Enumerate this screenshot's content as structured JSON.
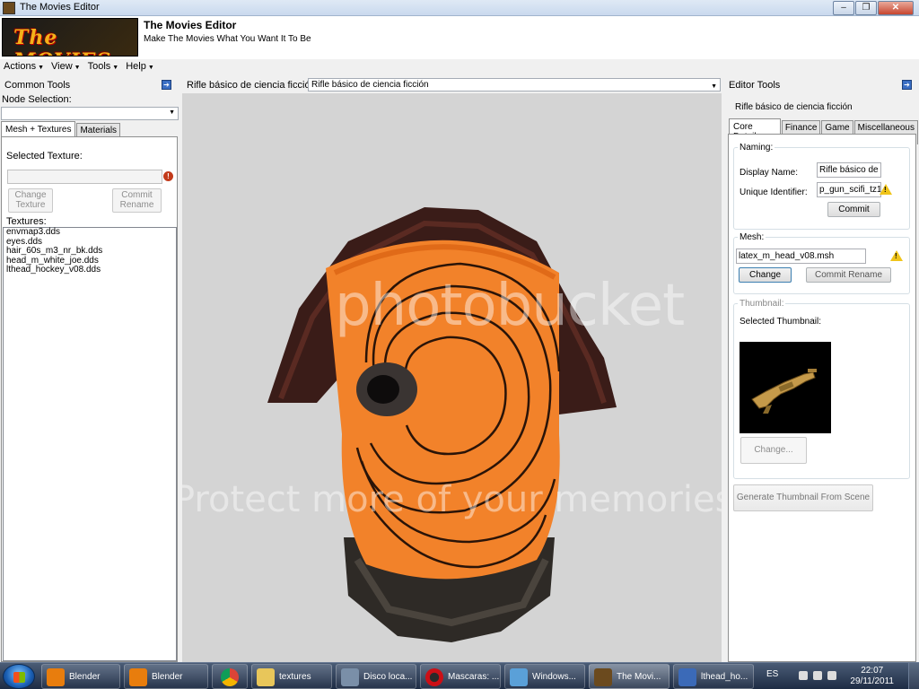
{
  "window": {
    "title": "The Movies Editor",
    "min": "–",
    "max": "❐",
    "close": "✕"
  },
  "banner": {
    "logo_text": "The MOVIES",
    "app_name": "The Movies Editor",
    "tagline": "Make The Movies What You Want It To Be"
  },
  "menu": [
    "Actions",
    "View",
    "Tools",
    "Help"
  ],
  "left": {
    "title": "Common Tools",
    "node_selection_label": "Node Selection:",
    "node_selection_value": "",
    "tabs": [
      "Mesh + Textures",
      "Materials"
    ],
    "selected_texture_label": "Selected Texture:",
    "selected_texture_value": "",
    "change_texture": "Change Texture",
    "commit_rename": "Commit Rename",
    "textures_label": "Textures:",
    "textures": [
      "envmap3.dds",
      "eyes.dds",
      "hair_60s_m3_nr_bk.dds",
      "head_m_white_joe.dds",
      "lthead_hockey_v08.dds"
    ]
  },
  "center": {
    "asset_label": "Rifle básico de ciencia ficción",
    "asset_selected": "Rifle básico de ciencia ficción",
    "watermark_logo": "photobucket",
    "watermark_slogan": "Protect more of your memories for less!"
  },
  "right": {
    "title": "Editor Tools",
    "asset_name": "Rifle básico de ciencia ficción",
    "tabs": [
      "Core Details",
      "Finance",
      "Game",
      "Miscellaneous"
    ],
    "naming_title": "Naming:",
    "display_name_label": "Display Name:",
    "display_name_value": "Rifle básico de ciencia ficción",
    "unique_id_label": "Unique Identifier:",
    "unique_id_value": "p_gun_scifi_tz1",
    "commit": "Commit",
    "mesh_title": "Mesh:",
    "mesh_value": "latex_m_head_v08.msh",
    "change": "Change",
    "commit_rename": "Commit Rename",
    "thumbnail_title": "Thumbnail:",
    "selected_thumbnail_label": "Selected Thumbnail:",
    "thumb_change": "Change...",
    "generate_thumbnail": "Generate Thumbnail From Scene"
  },
  "taskbar": {
    "items": [
      {
        "label": "Blender",
        "color": "#e87d0d"
      },
      {
        "label": "Blender",
        "color": "#e87d0d"
      },
      {
        "label": "",
        "color": "#4caf50"
      },
      {
        "label": "textures",
        "color": "#e8c65a"
      },
      {
        "label": "Disco loca...",
        "color": "#7a8fa8"
      },
      {
        "label": "Mascaras: ...",
        "color": "#cc0f16"
      },
      {
        "label": "Windows...",
        "color": "#5aa0d8"
      },
      {
        "label": "The Movi...",
        "color": "#6b4a1e"
      },
      {
        "label": "lthead_ho...",
        "color": "#3b6ab8"
      }
    ],
    "lang": "ES",
    "time": "22:07",
    "date": "29/11/2011"
  }
}
